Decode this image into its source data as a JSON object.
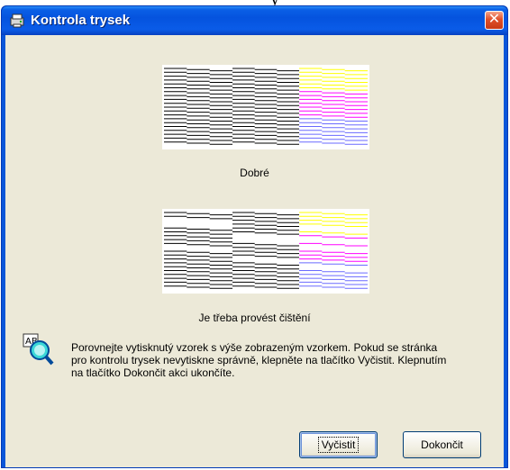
{
  "backdrop": {
    "text": "y"
  },
  "window": {
    "title": "Kontrola trysek",
    "close_glyph": "✕",
    "icon": "printer-nozzle-icon"
  },
  "patterns": {
    "good_caption": "Dobré",
    "bad_caption": "Je třeba provést čištění"
  },
  "info": {
    "icon": "magnifier-info-icon",
    "text": "Porovnejte vytisknutý vzorek s výše zobrazeným vzorkem. Pokud se stránka pro kontrolu trysek nevytiskne správně, klepněte na tlačítko Vyčistit. Klepnutím na tlačítko Dokončit akci ukončíte."
  },
  "buttons": {
    "clean": "Vyčistit",
    "finish": "Dokončit"
  },
  "colors": {
    "title_bar": "#0a5ce8",
    "dialog_bg": "#ece9d8",
    "close_button": "#e0502a",
    "black_ink": "#000000",
    "magenta_ink": "#ff00ff",
    "yellow_ink": "#ffff00",
    "cyan_ink": "#6a6aff"
  }
}
